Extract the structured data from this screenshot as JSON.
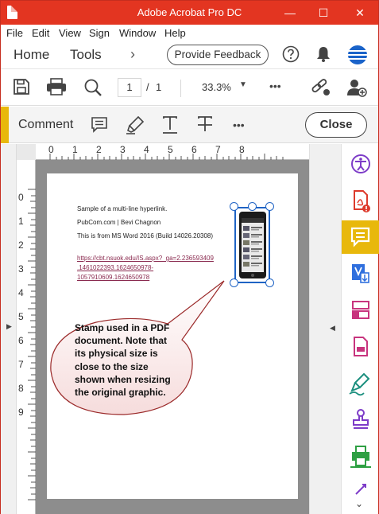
{
  "window": {
    "title": "Adobe Acrobat Pro DC",
    "controls": {
      "minimize": "—",
      "maximize": "☐",
      "close": "✕"
    }
  },
  "menu": [
    "File",
    "Edit",
    "View",
    "Sign",
    "Window",
    "Help"
  ],
  "nav": {
    "home": "Home",
    "tools": "Tools",
    "chevron": "›",
    "feedback": "Provide Feedback"
  },
  "toolbar": {
    "page_current": "1",
    "page_sep": "/",
    "page_total": "1",
    "zoom": "33.3%",
    "more": "•••"
  },
  "comment": {
    "label": "Comment",
    "more": "•••",
    "close": "Close"
  },
  "ruler": {
    "horizontal": [
      "0",
      "1",
      "2",
      "3",
      "4",
      "5",
      "6",
      "7",
      "8"
    ],
    "vertical": [
      "0",
      "1",
      "2",
      "3",
      "4",
      "5",
      "6",
      "7",
      "8",
      "9"
    ]
  },
  "document": {
    "lines": [
      "Sample of a multi-line hyperlink.",
      "PubCom.com | Bevi Chagnon",
      "This is from MS Word 2016 (Build 14026.20308)"
    ],
    "link": [
      "https://cbt.nsuok.edu/IS.aspx?_ga=2.236593409",
      ".1461022393.1624650978-",
      "1057910609.1624650978"
    ],
    "callout": "Stamp used in a PDF document. Note that its physical size is close to the size shown when resizing the original graphic."
  },
  "colors": {
    "titlebar": "#e33521",
    "accent": "#e8b80c",
    "selection": "#1f63c4",
    "link": "#8a2a4f",
    "callout_border": "#9b2a2a",
    "purple": "#7d3cc8",
    "red": "#dd3a2c",
    "blue": "#2f6fde",
    "pink": "#c8347e",
    "teal": "#1b8f7e",
    "green": "#2ea043"
  }
}
